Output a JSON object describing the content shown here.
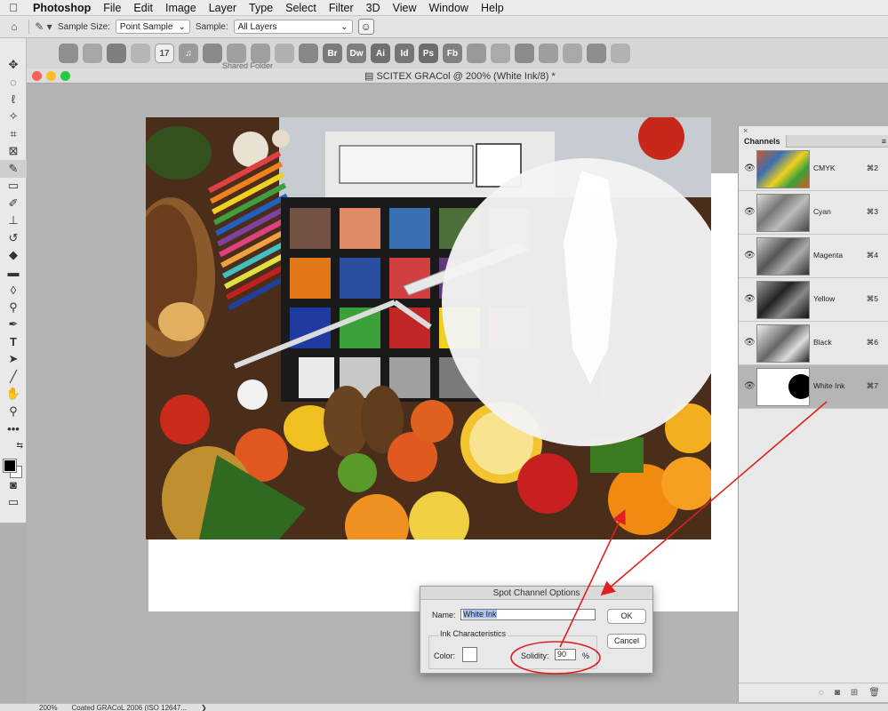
{
  "menubar": {
    "items": [
      "Photoshop",
      "File",
      "Edit",
      "Image",
      "Layer",
      "Type",
      "Select",
      "Filter",
      "3D",
      "View",
      "Window",
      "Help"
    ]
  },
  "options": {
    "sample_size_label": "Sample Size:",
    "sample_size_value": "Point Sample",
    "sample_label": "Sample:",
    "sample_value": "All Layers"
  },
  "dock": {
    "tiles": [
      "17",
      "♫",
      "",
      "",
      "",
      "Br",
      "Dw",
      "Ai",
      "Id",
      "Ps",
      "Fb",
      "",
      "",
      "",
      ""
    ],
    "shared_folder": "Shared Folder"
  },
  "document": {
    "title": "SCITEX GRACol @ 200% (White Ink/8) *"
  },
  "status": {
    "zoom": "200%",
    "profile": "Coated GRACoL 2006 (ISO 12647...",
    "arrow": "❯"
  },
  "channels_panel": {
    "close": "×",
    "tab": "Channels",
    "channels": [
      {
        "name": "CMYK",
        "shortcut": "⌘2",
        "selected": false
      },
      {
        "name": "Cyan",
        "shortcut": "⌘3",
        "selected": false
      },
      {
        "name": "Magenta",
        "shortcut": "⌘4",
        "selected": false
      },
      {
        "name": "Yellow",
        "shortcut": "⌘5",
        "selected": false
      },
      {
        "name": "Black",
        "shortcut": "⌘6",
        "selected": false
      },
      {
        "name": "White Ink",
        "shortcut": "⌘7",
        "selected": true
      }
    ]
  },
  "dialog": {
    "title": "Spot Channel Options",
    "name_label": "Name:",
    "name_value": "White Ink",
    "group_label": "Ink Characteristics",
    "color_label": "Color:",
    "solidity_label": "Solidity:",
    "solidity_value": "90",
    "percent": "%",
    "ok": "OK",
    "cancel": "Cancel"
  },
  "colors": {
    "annotation": "#e02020",
    "selection": "#b5b5b5"
  }
}
